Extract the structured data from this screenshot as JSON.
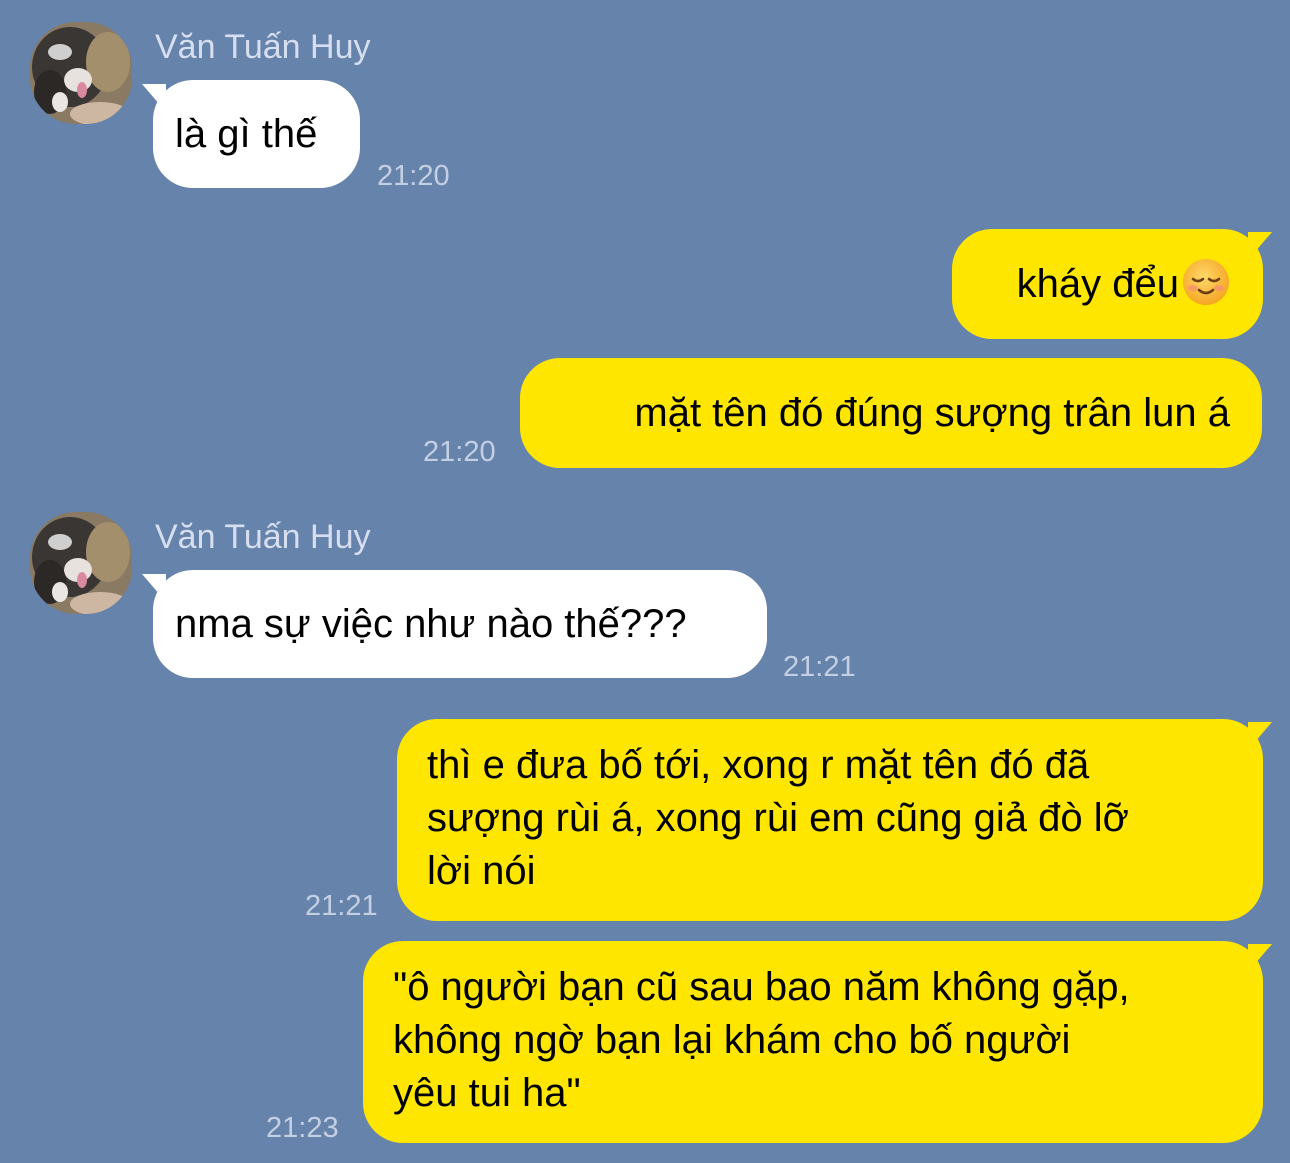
{
  "messages": [
    {
      "direction": "incoming",
      "sender": "Văn Tuấn Huy",
      "text": "là gì thế",
      "time": "21:20"
    },
    {
      "direction": "outgoing",
      "text": "kháy đểu",
      "emoji": "smiling-face-icon"
    },
    {
      "direction": "outgoing",
      "text": "mặt tên đó đúng sượng trân lun á",
      "time": "21:20"
    },
    {
      "direction": "incoming",
      "sender": "Văn Tuấn Huy",
      "text": "nma sự việc như nào thế???",
      "time": "21:21"
    },
    {
      "direction": "outgoing",
      "lines": [
        "thì e đưa bố tới, xong r mặt tên đó đã",
        "sượng rùi á, xong rùi em cũng giả đò lỡ",
        "lời nói"
      ],
      "time": "21:21"
    },
    {
      "direction": "outgoing",
      "lines": [
        "\"ô người bạn cũ sau bao năm không gặp,",
        "không ngờ bạn lại khám cho bố người",
        "yêu tui ha\""
      ],
      "time": "21:23"
    }
  ],
  "colors": {
    "background": "#6683ab",
    "incoming_bubble": "#ffffff",
    "outgoing_bubble": "#ffe600",
    "timestamp": "#c4cfe3",
    "sender_name": "#d6def0"
  }
}
